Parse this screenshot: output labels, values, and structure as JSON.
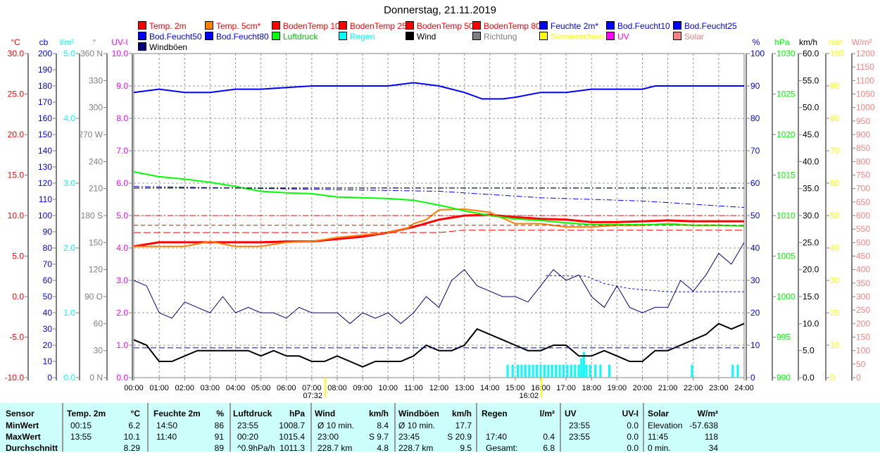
{
  "title": "Donnerstag, 21.11.2019",
  "legend": [
    {
      "label": "Temp. 2m",
      "color": "#ff0000",
      "text": "#ff0000"
    },
    {
      "label": "Temp. 5cm*",
      "color": "#ff8000",
      "text": "#ff0000"
    },
    {
      "label": "BodenTemp 10",
      "color": "#ff0000",
      "text": "#ff0000"
    },
    {
      "label": "BodenTemp 25",
      "color": "#ff0000",
      "text": "#ff0000"
    },
    {
      "label": "BodenTemp 50",
      "color": "#ff0000",
      "text": "#ff0000"
    },
    {
      "label": "BodenTemp 80",
      "color": "#ff0000",
      "text": "#ff0000"
    },
    {
      "label": "Feuchte 2m*",
      "color": "#0000ff",
      "text": "#0000ff"
    },
    {
      "label": "Bod.Feucht10",
      "color": "#0000ff",
      "text": "#0000ff"
    },
    {
      "label": "Bod.Feucht25",
      "color": "#0000ff",
      "text": "#0000ff"
    },
    {
      "label": "Bod.Feucht50",
      "color": "#0000ff",
      "text": "#0000ff"
    },
    {
      "label": "Bod.Feucht80",
      "color": "#0000ff",
      "text": "#0000ff"
    },
    {
      "label": "Luftdruck",
      "color": "#00ff00",
      "text": "#00c000"
    },
    {
      "label": "Regen",
      "color": "#00ffff",
      "text": "#00ffff"
    },
    {
      "label": "Wind",
      "color": "#000000",
      "text": "#000000"
    },
    {
      "label": "Richtung",
      "color": "#808080",
      "text": "#808080"
    },
    {
      "label": "Sonnenschein",
      "color": "#ffff00",
      "text": "#ffff00"
    },
    {
      "label": "UV",
      "color": "#ff00ff",
      "text": "#ff00ff"
    },
    {
      "label": "Solar",
      "color": "#ff8080",
      "text": "#ff8080"
    },
    {
      "label": "Windböen",
      "color": "#000080",
      "text": "#000000"
    }
  ],
  "chart_data": {
    "type": "line",
    "title": "Donnerstag, 21.11.2019",
    "x_ticks": [
      "00:00",
      "01:00",
      "02:00",
      "03:00",
      "04:00",
      "05:00",
      "06:00",
      "07:00",
      "08:00",
      "09:00",
      "10:00",
      "11:00",
      "12:00",
      "13:00",
      "14:00",
      "15:00",
      "16:00",
      "17:00",
      "18:00",
      "19:00",
      "20:00",
      "21:00",
      "22:00",
      "23:00",
      "24:00"
    ],
    "x_hours": [
      0,
      1,
      2,
      3,
      4,
      5,
      6,
      7,
      8,
      9,
      10,
      11,
      12,
      13,
      14,
      15,
      16,
      17,
      18,
      19,
      20,
      21,
      22,
      23,
      24
    ],
    "axes_left": [
      {
        "unit": "°C",
        "color": "#ff0000",
        "min": -10,
        "max": 30,
        "step": 5,
        "dec": 1
      },
      {
        "unit": "cb",
        "color": "#0000ff",
        "min": 0,
        "max": 200,
        "step": 10,
        "dec": 0
      },
      {
        "unit": "l/m²",
        "color": "#00ffff",
        "min": 0,
        "max": 5,
        "step": 1,
        "dec": 1
      },
      {
        "unit": "°",
        "color": "#808080",
        "min": 0,
        "max": 360,
        "step": 30,
        "dec": 0,
        "dirs": {
          "0": "N",
          "90": "O",
          "180": "S",
          "270": "W",
          "360": "N"
        }
      },
      {
        "unit": "UV-I",
        "color": "#ff00ff",
        "min": 0,
        "max": 10,
        "step": 1,
        "dec": 1
      }
    ],
    "axes_right": [
      {
        "unit": "%",
        "color": "#0000ff",
        "min": 0,
        "max": 100,
        "step": 10,
        "dec": 0
      },
      {
        "unit": "hPa",
        "color": "#00ff00",
        "min": 990,
        "max": 1030,
        "step": 5,
        "dec": 0
      },
      {
        "unit": "km/h",
        "color": "#000000",
        "min": 0,
        "max": 60,
        "step": 5,
        "dec": 1
      },
      {
        "unit": "min",
        "color": "#ffff00",
        "min": 0,
        "max": 100,
        "step": 10,
        "dec": 0
      },
      {
        "unit": "W/m²",
        "color": "#ff8080",
        "min": 0,
        "max": 1200,
        "step": 50,
        "dec": 0
      }
    ],
    "series": [
      {
        "name": "Temp. 2m",
        "axis": "°C",
        "color": "#ff0000",
        "width": 3,
        "hours": [
          0,
          1,
          2,
          3,
          4,
          5,
          6,
          7,
          8,
          9,
          10,
          11,
          12,
          13,
          14,
          15,
          16,
          17,
          18,
          19,
          20,
          21,
          22,
          23,
          24
        ],
        "values": [
          6.2,
          6.7,
          6.7,
          6.7,
          6.7,
          6.7,
          6.8,
          6.8,
          7.1,
          7.4,
          7.9,
          8.6,
          9.5,
          10.0,
          10.1,
          9.8,
          9.6,
          9.5,
          9.2,
          9.2,
          9.3,
          9.4,
          9.3,
          9.3,
          9.3
        ]
      },
      {
        "name": "Temp. 5cm*",
        "axis": "°C",
        "color": "#ff8000",
        "width": 2,
        "hours": [
          0,
          2,
          3,
          4,
          5,
          6,
          7,
          8,
          9,
          10,
          10.8,
          11,
          11.5,
          12,
          13,
          14,
          15,
          16,
          17,
          18,
          19,
          20,
          21,
          22,
          23,
          24
        ],
        "values": [
          6.2,
          6.2,
          6.8,
          6.2,
          6.2,
          6.7,
          6.8,
          7.3,
          7.6,
          7.9,
          8.5,
          9.0,
          9.5,
          10.7,
          10.8,
          10.4,
          9.0,
          9.0,
          8.6,
          8.6,
          8.8,
          8.8,
          9.0,
          8.8,
          8.8,
          8.7
        ]
      },
      {
        "name": "Feuchte 2m*",
        "axis": "%",
        "color": "#0000ff",
        "width": 2,
        "hours": [
          0,
          1,
          2,
          3,
          4,
          5,
          6,
          7,
          8,
          9,
          10,
          11,
          12,
          13,
          13.7,
          14.5,
          15,
          16,
          17,
          18,
          19,
          20,
          20.5,
          21,
          24
        ],
        "values": [
          88,
          89,
          88,
          88,
          89,
          89,
          89.5,
          90,
          90,
          90,
          90,
          91,
          90,
          88,
          86,
          86,
          86.5,
          88,
          88,
          89,
          89,
          89,
          90,
          90,
          90
        ]
      },
      {
        "name": "Luftdruck",
        "axis": "hPa",
        "color": "#00ff00",
        "width": 2,
        "hours": [
          0,
          1,
          2,
          3,
          4,
          5,
          6,
          7,
          8,
          9,
          10,
          11,
          12,
          13,
          14,
          15,
          16,
          17,
          18,
          19,
          20,
          21,
          22,
          23,
          24
        ],
        "values": [
          1015.4,
          1014.8,
          1014.5,
          1014.1,
          1013.6,
          1013.0,
          1012.8,
          1012.7,
          1012.3,
          1012.2,
          1012.1,
          1011.9,
          1011.3,
          1010.6,
          1010.0,
          1009.6,
          1009.4,
          1009.1,
          1008.9,
          1008.9,
          1008.9,
          1008.9,
          1008.8,
          1008.8,
          1008.7
        ]
      },
      {
        "name": "BodenTemp 80",
        "axis": "°C",
        "color": "#ff0000",
        "width": 1,
        "dash": "8,3,2,3",
        "hours": [
          0,
          24
        ],
        "values": [
          10.0,
          10.0
        ]
      },
      {
        "name": "BodenTemp 50",
        "axis": "°C",
        "color": "#ff0000",
        "width": 1,
        "dash": "6,4",
        "hours": [
          0,
          24
        ],
        "values": [
          8.8,
          8.8
        ]
      },
      {
        "name": "BodenTemp 25",
        "axis": "°C",
        "color": "#ff0000",
        "width": 1,
        "dash": "10,4",
        "hours": [
          0,
          12,
          13,
          24
        ],
        "values": [
          7.9,
          7.9,
          8.2,
          8.2
        ]
      },
      {
        "name": "Bod.Feucht10",
        "axis": "%",
        "color": "#0000ff",
        "width": 1,
        "dash": "8,3,2,3",
        "hours": [
          0,
          24
        ],
        "values": [
          58.5,
          58.5
        ]
      },
      {
        "name": "Bod.Feucht25",
        "axis": "%",
        "color": "#0000ff",
        "width": 1,
        "dash": "8,3,2,3",
        "hours": [
          0,
          8,
          12,
          16,
          20,
          24
        ],
        "values": [
          59,
          58,
          57.5,
          55.5,
          54.5,
          52.5
        ]
      },
      {
        "name": "Bod.Feucht50",
        "axis": "%",
        "color": "#000000",
        "width": 1,
        "dash": "8,3,2,3",
        "hours": [
          0,
          24
        ],
        "values": [
          58.5,
          58.5
        ]
      },
      {
        "name": "Bod.Feucht80",
        "axis": "%",
        "color": "#0000ff",
        "width": 1,
        "dash": "3,3",
        "hours": [
          16.2,
          17.8,
          18.5,
          19.5,
          21,
          24
        ],
        "values": [
          31.5,
          31.3,
          29,
          27.5,
          26.5,
          26.5
        ]
      },
      {
        "name": "Wind",
        "axis": "km/h",
        "color": "#000000",
        "width": 2,
        "step": 0.5,
        "values": [
          7,
          6,
          3,
          3,
          4,
          5,
          5,
          5,
          5,
          5,
          4,
          5,
          4,
          4,
          3,
          3,
          4,
          3,
          2,
          3,
          3,
          3,
          4,
          6,
          5,
          5,
          6,
          9,
          8,
          7,
          6,
          5,
          5,
          6,
          6,
          4,
          4,
          5,
          4,
          3,
          3,
          5,
          5,
          6,
          7,
          8,
          10,
          9,
          10
        ]
      },
      {
        "name": "Windböen",
        "axis": "km/h",
        "color": "#000080",
        "width": 1,
        "step": 0.5,
        "values": [
          18,
          17,
          12,
          11,
          14,
          13,
          12,
          15,
          12,
          13,
          12,
          12,
          11,
          13,
          12,
          12,
          12,
          10,
          12,
          11,
          12,
          10,
          12,
          15,
          13,
          18,
          20,
          17,
          16,
          15,
          15,
          14,
          17,
          20,
          18,
          19,
          15,
          13,
          17,
          13,
          12,
          13,
          13,
          18,
          16,
          19,
          23,
          21,
          25
        ]
      },
      {
        "name": "Wind Ø",
        "axis": "km/h",
        "color": "#0000ff",
        "width": 1,
        "dash": "8,4",
        "hours": [
          0,
          24
        ],
        "values": [
          5.5,
          5.5
        ]
      }
    ],
    "rain_bars": {
      "axis": "l/m²",
      "hours": [
        14.7,
        14.9,
        15.1,
        15.25,
        15.4,
        15.55,
        15.7,
        15.85,
        16.0,
        16.15,
        16.3,
        16.45,
        16.6,
        16.75,
        16.9,
        17.05,
        17.2,
        17.35,
        17.5,
        17.6,
        17.7,
        17.8,
        17.95,
        18.15,
        18.35,
        18.7,
        21.95,
        23.55,
        23.75
      ],
      "values": [
        0.2,
        0.2,
        0.2,
        0.2,
        0.2,
        0.2,
        0.2,
        0.2,
        0.2,
        0.2,
        0.2,
        0.2,
        0.2,
        0.2,
        0.2,
        0.2,
        0.2,
        0.2,
        0.2,
        0.3,
        0.4,
        0.2,
        0.2,
        0.2,
        0.2,
        0.2,
        0.2,
        0.2,
        0.2
      ]
    },
    "sun_markers": [
      {
        "label": "07:32",
        "hour": 7.53
      },
      {
        "label": "16:02",
        "hour": 16.03
      }
    ]
  },
  "stats": {
    "headers": [
      "Sensor",
      "Temp. 2m",
      "°C",
      "Feuchte 2m",
      "%",
      "Luftdruck",
      "hPa",
      "Wind",
      "km/h",
      "Windböen",
      "km/h",
      "Regen",
      "l/m²",
      "UV",
      "UV-I",
      "Solar",
      "W/m²"
    ],
    "rows": [
      {
        "label": "MinWert",
        "cells": [
          "00:15",
          "6.2",
          "14:50",
          "86",
          "23:55",
          "1008.7",
          "Ø 10 min.",
          "8.4",
          "Ø 10 min.",
          "17.7",
          "",
          "",
          "23:55",
          "0.0",
          "Elevation",
          "-57.638"
        ]
      },
      {
        "label": "MaxWert",
        "cells": [
          "13:55",
          "10.1",
          "11:40",
          "91",
          "00:20",
          "1015.4",
          "23:00",
          "S 9.7",
          "23:45",
          "S 20.9",
          "17:40",
          "0.4",
          "23:55",
          "0.0",
          "11:45",
          "118"
        ]
      },
      {
        "label": "Durchschnitt",
        "cells": [
          "",
          "8.29",
          "",
          "89",
          "^0.9hPa/h",
          "1011.3",
          "228.7 km",
          "4.8",
          "228.7 km",
          "9.5",
          "Gesamt:",
          "6.8",
          "",
          "0.0",
          "0 min.",
          "34"
        ]
      }
    ]
  }
}
